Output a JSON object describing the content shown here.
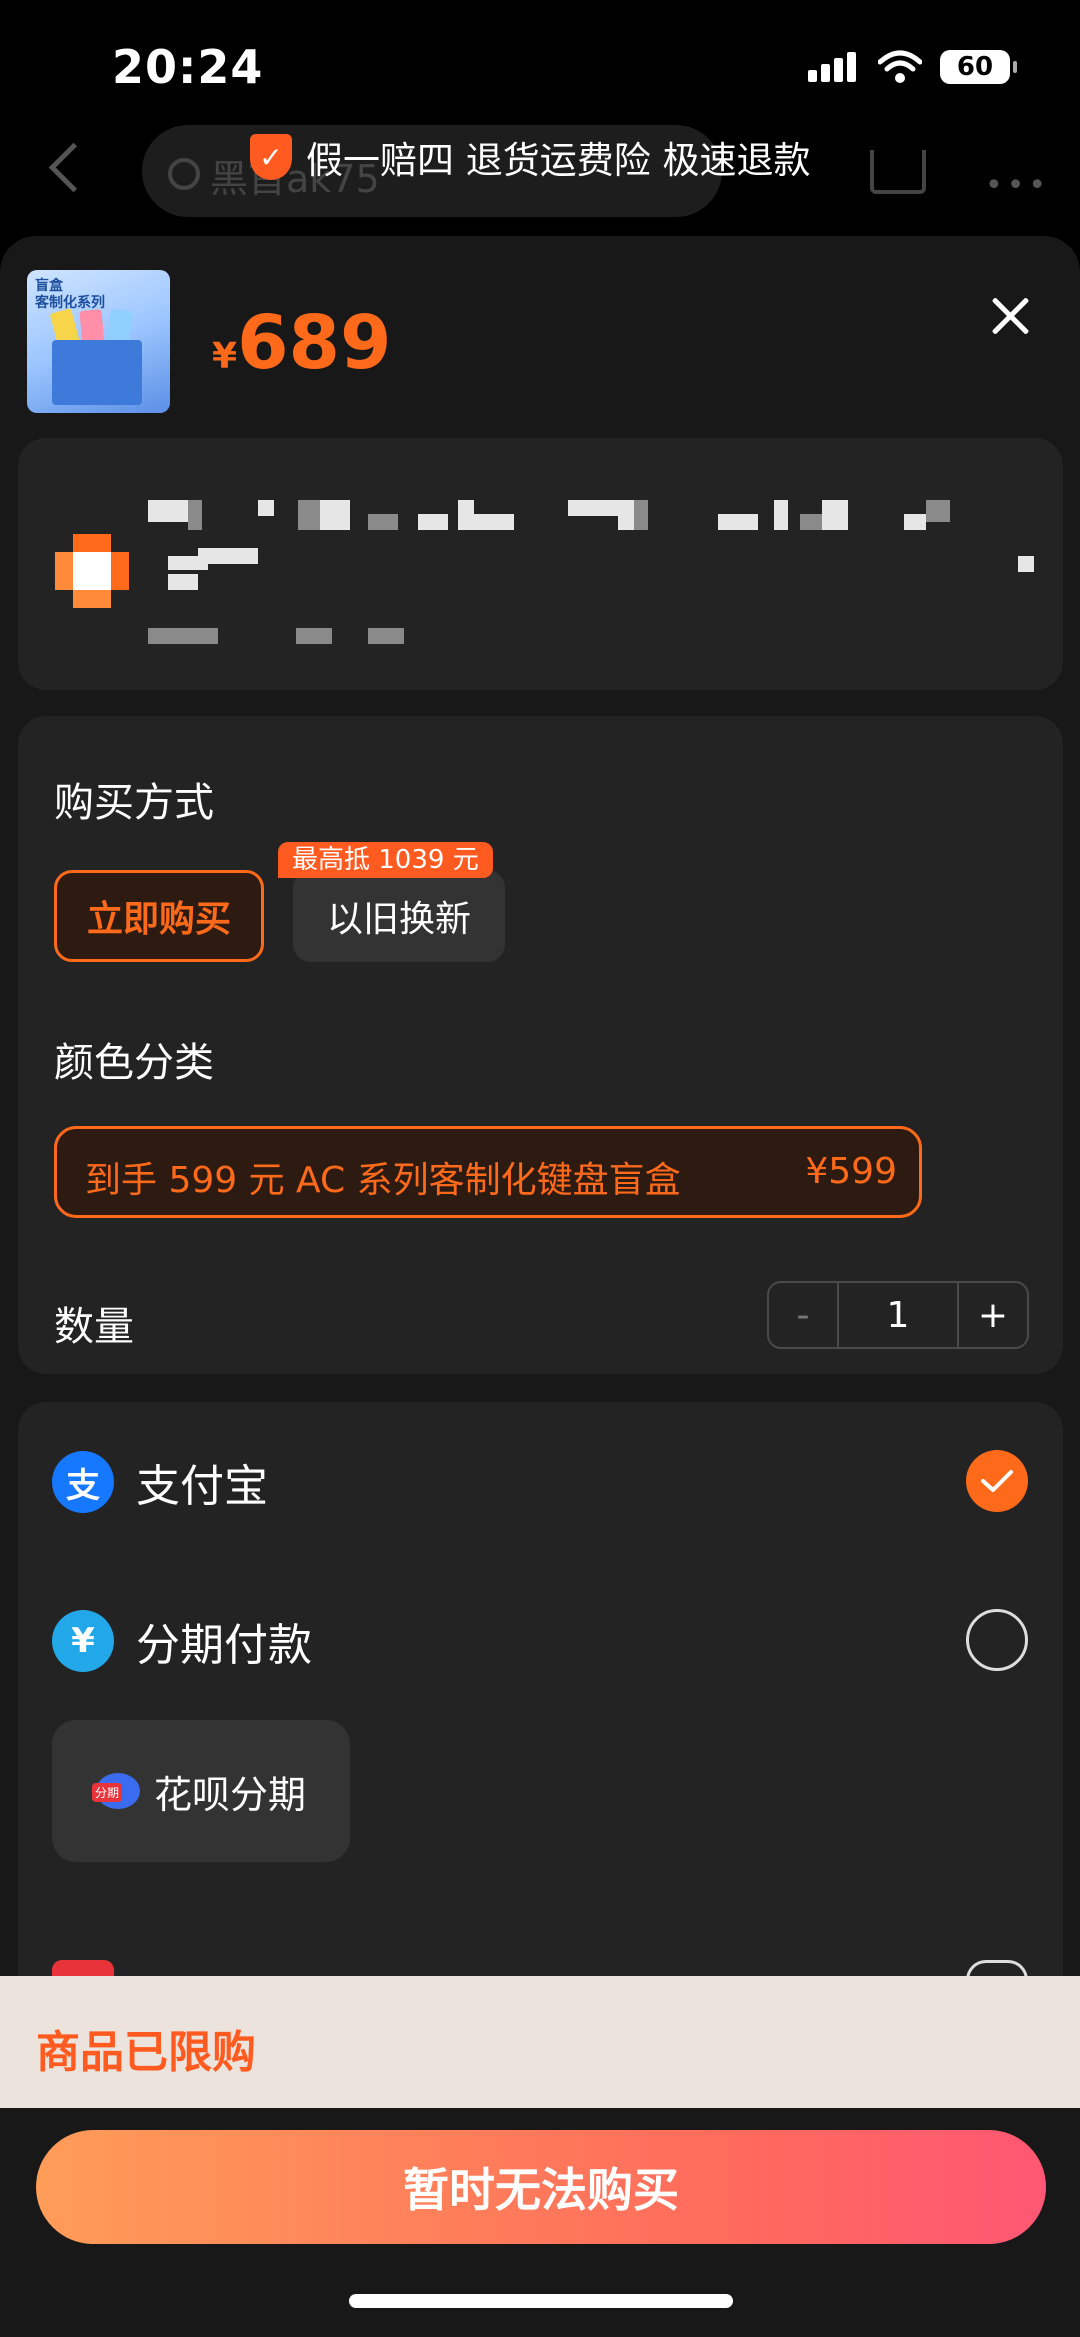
{
  "status_bar": {
    "time": "20:24",
    "battery": "60"
  },
  "background_nav": {
    "search_text": "黑首ak75",
    "guarantee": "假一赔四 退货运费险 极速退款"
  },
  "product": {
    "price_symbol": "¥",
    "price": "689"
  },
  "purchase": {
    "section_label": "购买方式",
    "options": [
      {
        "label": "立即购买",
        "selected": true
      },
      {
        "label": "以旧换新",
        "badge": "最高抵 1039 元",
        "selected": false
      }
    ]
  },
  "color": {
    "section_label": "颜色分类",
    "variant_name": "到手 599 元 AC 系列客制化键盘盲盒",
    "variant_price": "¥599"
  },
  "quantity": {
    "label": "数量",
    "minus": "-",
    "value": "1",
    "plus": "+"
  },
  "payment": {
    "methods": [
      {
        "label": "支付宝",
        "icon": "alipay-icon",
        "selected": true
      },
      {
        "label": "分期付款",
        "icon": "installment-icon",
        "selected": false
      }
    ],
    "installment_option": {
      "label": "花呗分期",
      "icon_badge": "分期"
    }
  },
  "limit_notice": "商品已限购",
  "cta_label": "暂时无法购买",
  "colors": {
    "accent": "#ff6a1a",
    "sheet": "#181818",
    "card": "#232323",
    "alipay_blue": "#1677ff"
  }
}
